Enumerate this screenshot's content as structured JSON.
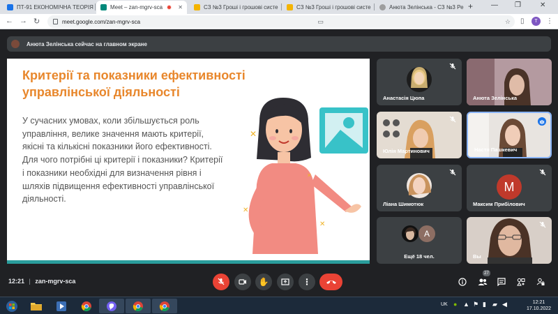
{
  "browser": {
    "tabs": [
      {
        "title": "ПТ-91 ЕКОНОМІЧНА ТЕОРІЯ",
        "favicon_color": "#1a73e8",
        "active": false
      },
      {
        "title": "Meet – zan-mgrv-sca",
        "favicon_color": "#00897b",
        "active": true
      },
      {
        "title": "СЗ №3 Гроші і грошові систе",
        "favicon_color": "#f4b400",
        "active": false
      },
      {
        "title": "СЗ №3 Гроші і грошові систе",
        "favicon_color": "#f4b400",
        "active": false
      },
      {
        "title": "Анюта Зелінська - СЗ №3 Ре",
        "favicon_color": "#9e9e9e",
        "active": false
      }
    ],
    "url": "meet.google.com/zan-mgrv-sca",
    "profile_initial": "T"
  },
  "meet": {
    "presenting_banner": "Анюта Зелінська сейчас на главном экране",
    "slide": {
      "title": "Критерії та показники ефективності управлінської діяльності",
      "body": "У сучасних умовах, коли збільшується роль управління, велике значення мають критерії, якісні та кількісні показники його ефективності. Для чого потрібні ці критерії і показники? Критерії і показники необхідні для визначення рівня і шляхів підвищення ефективності управлінської діяльності."
    },
    "participants": [
      {
        "name": "Анастасія Цюпа",
        "muted": true
      },
      {
        "name": "Анюта Зелінська",
        "muted": false
      },
      {
        "name": "Юлія Мартинович",
        "muted": true
      },
      {
        "name": "Настя Пашкевич",
        "muted": false,
        "speaking": true
      },
      {
        "name": "Ліана Шимотюк",
        "muted": true
      },
      {
        "name": "Максим Прибілович",
        "muted": true,
        "initial": "M",
        "avatar_color": "#c0392b"
      },
      {
        "name": "Ещё 18 чел.",
        "initial": "A",
        "avatar_color": "#8d6e63"
      },
      {
        "name": "Вы",
        "muted": true
      }
    ],
    "controls": {
      "time": "12:21",
      "meeting_code": "zan-mgrv-sca",
      "participant_count": "27"
    }
  },
  "taskbar": {
    "lang": "UK",
    "time": "12:21",
    "date": "17.10.2022"
  }
}
